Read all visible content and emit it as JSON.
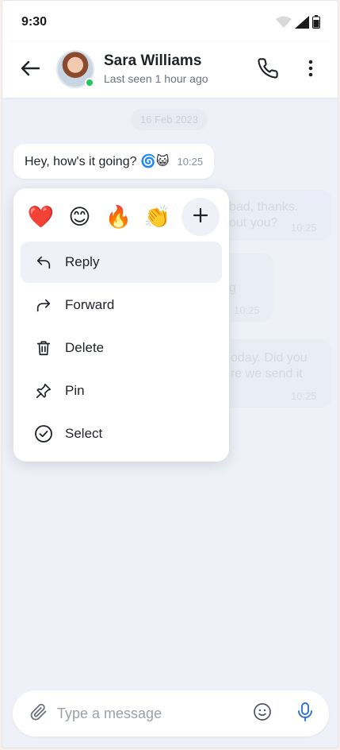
{
  "status_bar": {
    "time": "9:30",
    "icons": [
      "wifi-icon",
      "signal-icon",
      "battery-icon"
    ]
  },
  "header": {
    "contact_name": "Sara Williams",
    "contact_status": "Last seen 1 hour ago",
    "online": true,
    "icons": [
      "back-arrow-icon",
      "phone-icon",
      "more-vertical-icon"
    ]
  },
  "chat": {
    "date_label": "16 Feb 2023",
    "selected_message": {
      "text": "Hey, how's it going? 🌀😺",
      "time": "10:25"
    },
    "background_messages": [
      {
        "lines": [
          "bad, thanks.",
          "out you?"
        ],
        "time": "10:25"
      },
      {
        "lines": [
          "g"
        ],
        "time": "10:25"
      },
      {
        "lines": [
          "oday. Did you",
          "re we send it"
        ],
        "time": "10:25"
      }
    ]
  },
  "context_menu": {
    "reactions": [
      "❤️",
      "😊",
      "🔥",
      "👏"
    ],
    "more_reactions_icon": "plus-icon",
    "items": [
      {
        "label": "Reply",
        "icon": "reply-icon",
        "active": true
      },
      {
        "label": "Forward",
        "icon": "forward-icon",
        "active": false
      },
      {
        "label": "Delete",
        "icon": "trash-icon",
        "active": false
      },
      {
        "label": "Pin",
        "icon": "pin-icon",
        "active": false
      },
      {
        "label": "Select",
        "icon": "check-circle-icon",
        "active": false
      }
    ]
  },
  "composer": {
    "placeholder": "Type a message",
    "value": "",
    "icons": [
      "paperclip-icon",
      "emoji-icon",
      "mic-icon"
    ],
    "mic_color": "#2f6fd6"
  },
  "colors": {
    "accent": "#2f6fd6",
    "online": "#22c55e",
    "chat_bg": "#eef1f8"
  }
}
